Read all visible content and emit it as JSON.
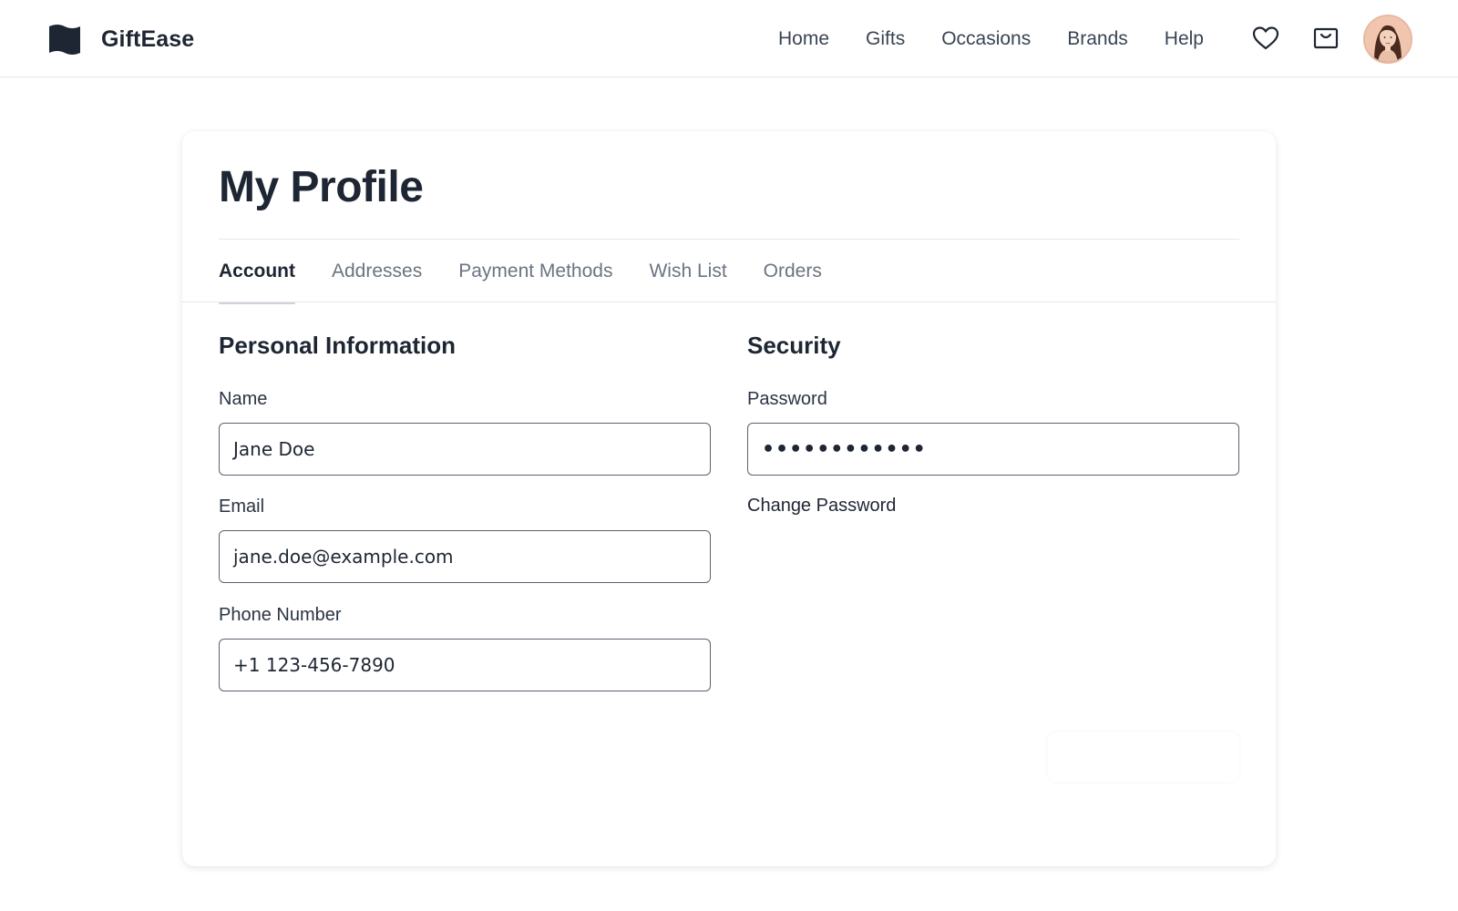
{
  "app": {
    "name": "GiftEase"
  },
  "nav": {
    "items": [
      {
        "label": "Home"
      },
      {
        "label": "Gifts"
      },
      {
        "label": "Occasions"
      },
      {
        "label": "Brands"
      },
      {
        "label": "Help"
      }
    ]
  },
  "icons": {
    "logo": "flag-icon",
    "wishlist": "heart-icon",
    "cart": "shopping-bag-icon",
    "avatar": "user-avatar"
  },
  "page": {
    "title": "My Profile"
  },
  "tabs": [
    {
      "label": "Account",
      "active": true
    },
    {
      "label": "Addresses",
      "active": false
    },
    {
      "label": "Payment Methods",
      "active": false
    },
    {
      "label": "Wish List",
      "active": false
    },
    {
      "label": "Orders",
      "active": false
    }
  ],
  "personal": {
    "title": "Personal Information",
    "name_label": "Name",
    "name_value": "Jane Doe",
    "email_label": "Email",
    "email_value": "jane.doe@example.com",
    "phone_label": "Phone Number",
    "phone_value": "+1 123-456-7890"
  },
  "security": {
    "title": "Security",
    "password_label": "Password",
    "password_value": "••••••••••••",
    "change_password": "Change Password"
  },
  "colors": {
    "text_primary": "#1e2633",
    "text_muted": "#6b7482",
    "input_border": "#5a6270",
    "divider": "#e6e8ec"
  }
}
